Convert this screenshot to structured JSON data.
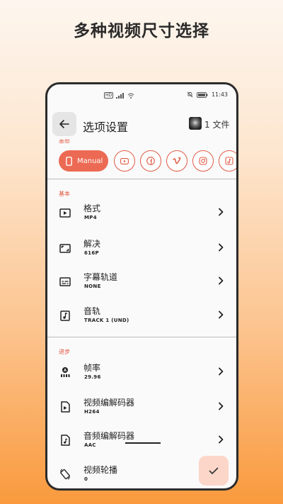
{
  "promo": {
    "title": "多种视频尺寸选择"
  },
  "statusbar": {
    "hd": "HD",
    "time": "11:43"
  },
  "appbar": {
    "title": "选项设置",
    "files_count": "1 文件"
  },
  "type_label": "类型",
  "presets": {
    "manual_label": "Manual",
    "items": [
      "youtube-icon",
      "facebook-icon",
      "vimeo-icon",
      "instagram-icon",
      "tiktok-icon"
    ]
  },
  "sections": {
    "basic": "基本",
    "advanced": "进步"
  },
  "basic_rows": [
    {
      "title": "格式",
      "value": "MP4"
    },
    {
      "title": "解决",
      "value": "616P"
    },
    {
      "title": "字幕轨道",
      "value": "NONE"
    },
    {
      "title": "音轨",
      "value": "TRACK 1 (UND)"
    }
  ],
  "advanced_rows": [
    {
      "title": "帧率",
      "value": "29.96"
    },
    {
      "title": "视频编解码器",
      "value": "H264"
    },
    {
      "title": "音频编解码器",
      "value": "AAC"
    },
    {
      "title": "视频轮播",
      "value": "0"
    }
  ],
  "colors": {
    "accent": "#ec6a54",
    "accent_text": "#e0553f",
    "fab_bg": "#fbd6c9"
  }
}
